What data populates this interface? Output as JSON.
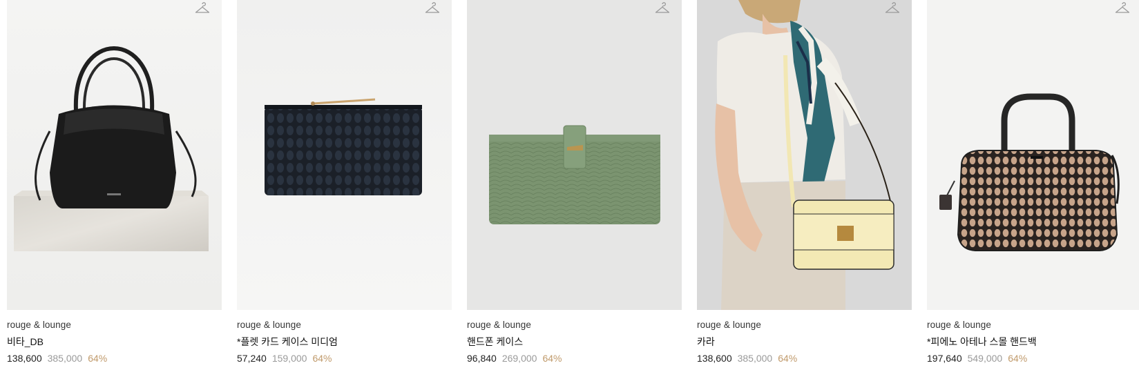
{
  "colors": {
    "discount": "#c09a6b",
    "original_price": "#9a9a9a",
    "text": "#222222"
  },
  "products": [
    {
      "brand": "rouge & lounge",
      "name": "비타_DB",
      "price": "138,600",
      "original_price": "385,000",
      "discount": "64%",
      "image": "black-drawstring-tote-on-marble",
      "wishlist_icon": "hanger-icon"
    },
    {
      "brand": "rouge & lounge",
      "name": "*플렛 카드 케이스 미디엄",
      "price": "57,240",
      "original_price": "159,000",
      "discount": "64%",
      "image": "navy-quilted-zip-pouch",
      "wishlist_icon": "hanger-icon"
    },
    {
      "brand": "rouge & lounge",
      "name": "핸드폰 케이스",
      "price": "96,840",
      "original_price": "269,000",
      "discount": "64%",
      "image": "green-croc-phone-wallet",
      "wishlist_icon": "hanger-icon"
    },
    {
      "brand": "rouge & lounge",
      "name": "카라",
      "price": "138,600",
      "original_price": "385,000",
      "discount": "64%",
      "image": "model-with-cream-shoulder-bag",
      "wishlist_icon": "hanger-icon"
    },
    {
      "brand": "rouge & lounge",
      "name": "*피에노 아테나 스몰 핸드백",
      "price": "197,640",
      "original_price": "549,000",
      "discount": "64%",
      "image": "beige-dotted-boston-bag",
      "wishlist_icon": "hanger-icon"
    }
  ]
}
